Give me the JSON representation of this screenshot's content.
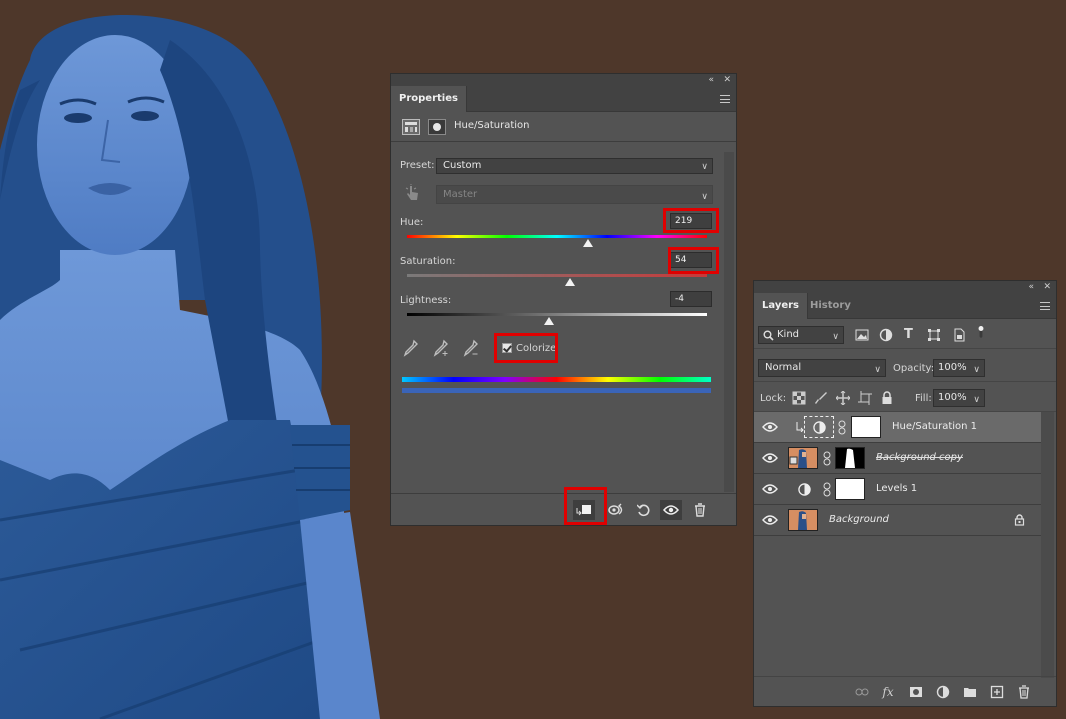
{
  "properties_panel": {
    "tab_label": "Properties",
    "adjustment_title": "Hue/Saturation",
    "preset_label": "Preset:",
    "preset_value": "Custom",
    "channel_value": "Master",
    "hue_label": "Hue:",
    "hue_value": "219",
    "saturation_label": "Saturation:",
    "saturation_value": "54",
    "lightness_label": "Lightness:",
    "lightness_value": "-4",
    "colorize_label": "Colorize",
    "colorize_checked": true
  },
  "layers_panel": {
    "tabs": [
      "Layers",
      "History"
    ],
    "filter_kind": "Kind",
    "blend_mode": "Normal",
    "opacity_label": "Opacity:",
    "opacity_value": "100%",
    "lock_label": "Lock:",
    "fill_label": "Fill:",
    "fill_value": "100%",
    "layers": [
      {
        "name": "Hue/Saturation 1",
        "selected": true
      },
      {
        "name": "Background copy",
        "selected": false
      },
      {
        "name": "Levels 1",
        "selected": false
      },
      {
        "name": "Background",
        "selected": false
      }
    ]
  },
  "colors": {
    "canvas_background": "#4e372a",
    "panel": "#535353",
    "highlight": "#e00000",
    "photo_tint": "#3f6fb2"
  }
}
